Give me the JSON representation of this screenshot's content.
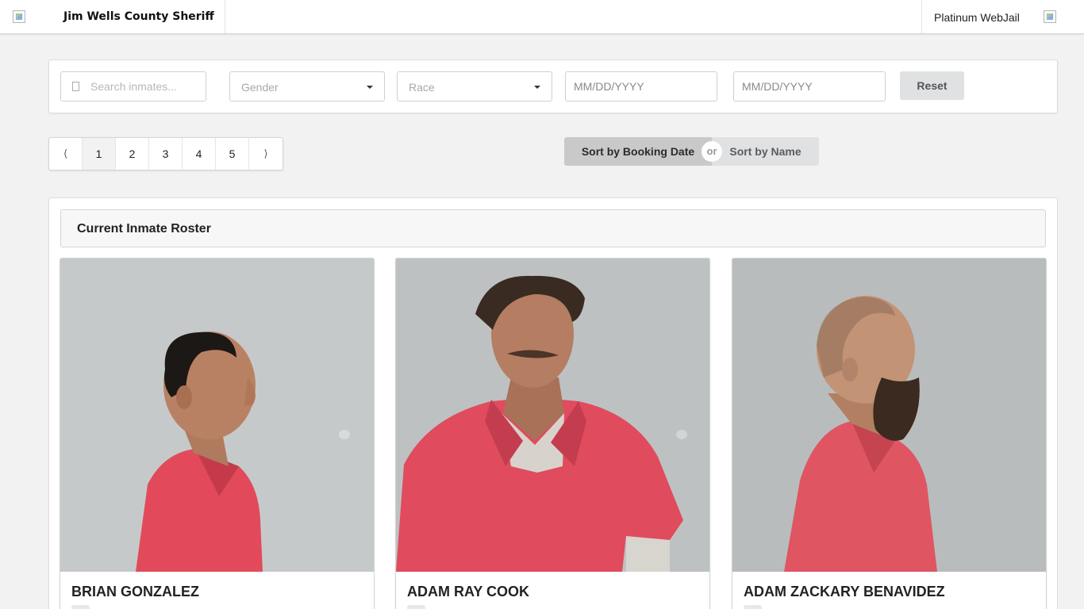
{
  "header": {
    "agency_name": "Jim Wells County Sheriff",
    "product_name": "Platinum WebJail"
  },
  "filters": {
    "search_placeholder": "Search inmates...",
    "gender_label": "Gender",
    "race_label": "Race",
    "date_from_placeholder": "MM/DD/YYYY",
    "date_to_placeholder": "MM/DD/YYYY",
    "reset_label": "Reset"
  },
  "pagination": {
    "prev": "⟨",
    "next": "⟩",
    "pages": [
      "1",
      "2",
      "3",
      "4",
      "5"
    ],
    "active_page": "1"
  },
  "sort": {
    "by_booking_date": "Sort by Booking Date",
    "or": "or",
    "by_name": "Sort by Name"
  },
  "roster": {
    "title": "Current Inmate Roster",
    "inmates": [
      {
        "name": "BRIAN GONZALEZ"
      },
      {
        "name": "ADAM RAY COOK"
      },
      {
        "name": "ADAM ZACKARY BENAVIDEZ"
      }
    ]
  },
  "colors": {
    "background": "#f2f2f2",
    "panel": "#ffffff",
    "sort_active": "#c9c9c9",
    "sort_inactive": "#e0e1e2",
    "jumpsuit": "#e0505e",
    "photo_backdrop": "#c4c7c8"
  }
}
